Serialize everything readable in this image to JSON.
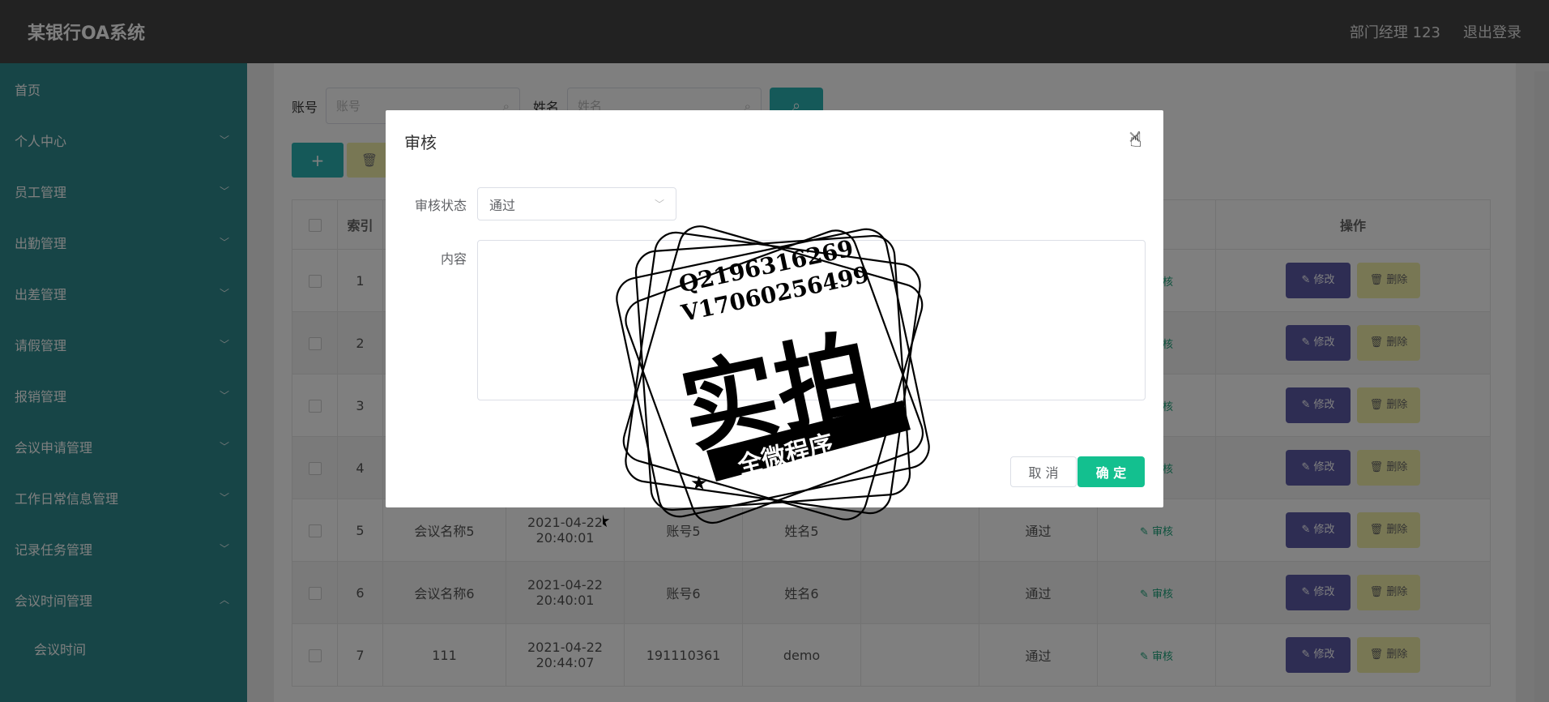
{
  "header": {
    "title": "某银行OA系统",
    "user": "部门经理 123",
    "logout": "退出登录"
  },
  "sidebar": {
    "items": [
      {
        "label": "首页",
        "expandable": false
      },
      {
        "label": "个人中心",
        "expandable": true
      },
      {
        "label": "员工管理",
        "expandable": true
      },
      {
        "label": "出勤管理",
        "expandable": true
      },
      {
        "label": "出差管理",
        "expandable": true
      },
      {
        "label": "请假管理",
        "expandable": true
      },
      {
        "label": "报销管理",
        "expandable": true
      },
      {
        "label": "会议申请管理",
        "expandable": true
      },
      {
        "label": "工作日常信息管理",
        "expandable": true
      },
      {
        "label": "记录任务管理",
        "expandable": true
      },
      {
        "label": "会议时间管理",
        "expandable": true,
        "expanded": true
      }
    ],
    "sub_item": "会议时间",
    "chevron_down": "﹀",
    "chevron_up": "︿"
  },
  "search": {
    "account_label": "账号",
    "account_placeholder": "账号",
    "name_label": "姓名",
    "name_placeholder": "姓名"
  },
  "actions": {
    "add_label": "+",
    "delete_label": "🗑"
  },
  "table": {
    "headers": {
      "index": "索引",
      "ops": "操作"
    },
    "rows": [
      {
        "index": "1"
      },
      {
        "index": "2"
      },
      {
        "index": "3"
      },
      {
        "index": "4"
      },
      {
        "index": "5",
        "meeting": "会议名称5",
        "time": "2021-04-22 20:40:01",
        "account": "账号5",
        "name": "姓名5",
        "status": "通过"
      },
      {
        "index": "6",
        "meeting": "会议名称6",
        "time": "2021-04-22 20:40:01",
        "account": "账号6",
        "name": "姓名6",
        "status": "通过"
      },
      {
        "index": "7",
        "meeting": "111",
        "time": "2021-04-22 20:44:07",
        "account": "191110361",
        "name": "demo",
        "status": "通过"
      }
    ],
    "audit_label": "审核",
    "edit_label": "修改",
    "delete_label": "删除"
  },
  "modal": {
    "title": "审核",
    "status_label": "审核状态",
    "status_value": "通过",
    "content_label": "内容",
    "cancel_label": "取 消",
    "ok_label": "确 定"
  },
  "watermark": {
    "line1": "Q2196316269",
    "line2": "V17060256499",
    "big": "实拍",
    "banner": "全微程序"
  },
  "colors": {
    "header": "#444444",
    "sidebar": "#2e8b8e",
    "primary": "#2ab3b3",
    "confirm": "#13c08f",
    "edit": "#5c5aa6",
    "delete": "#f0eea8"
  }
}
